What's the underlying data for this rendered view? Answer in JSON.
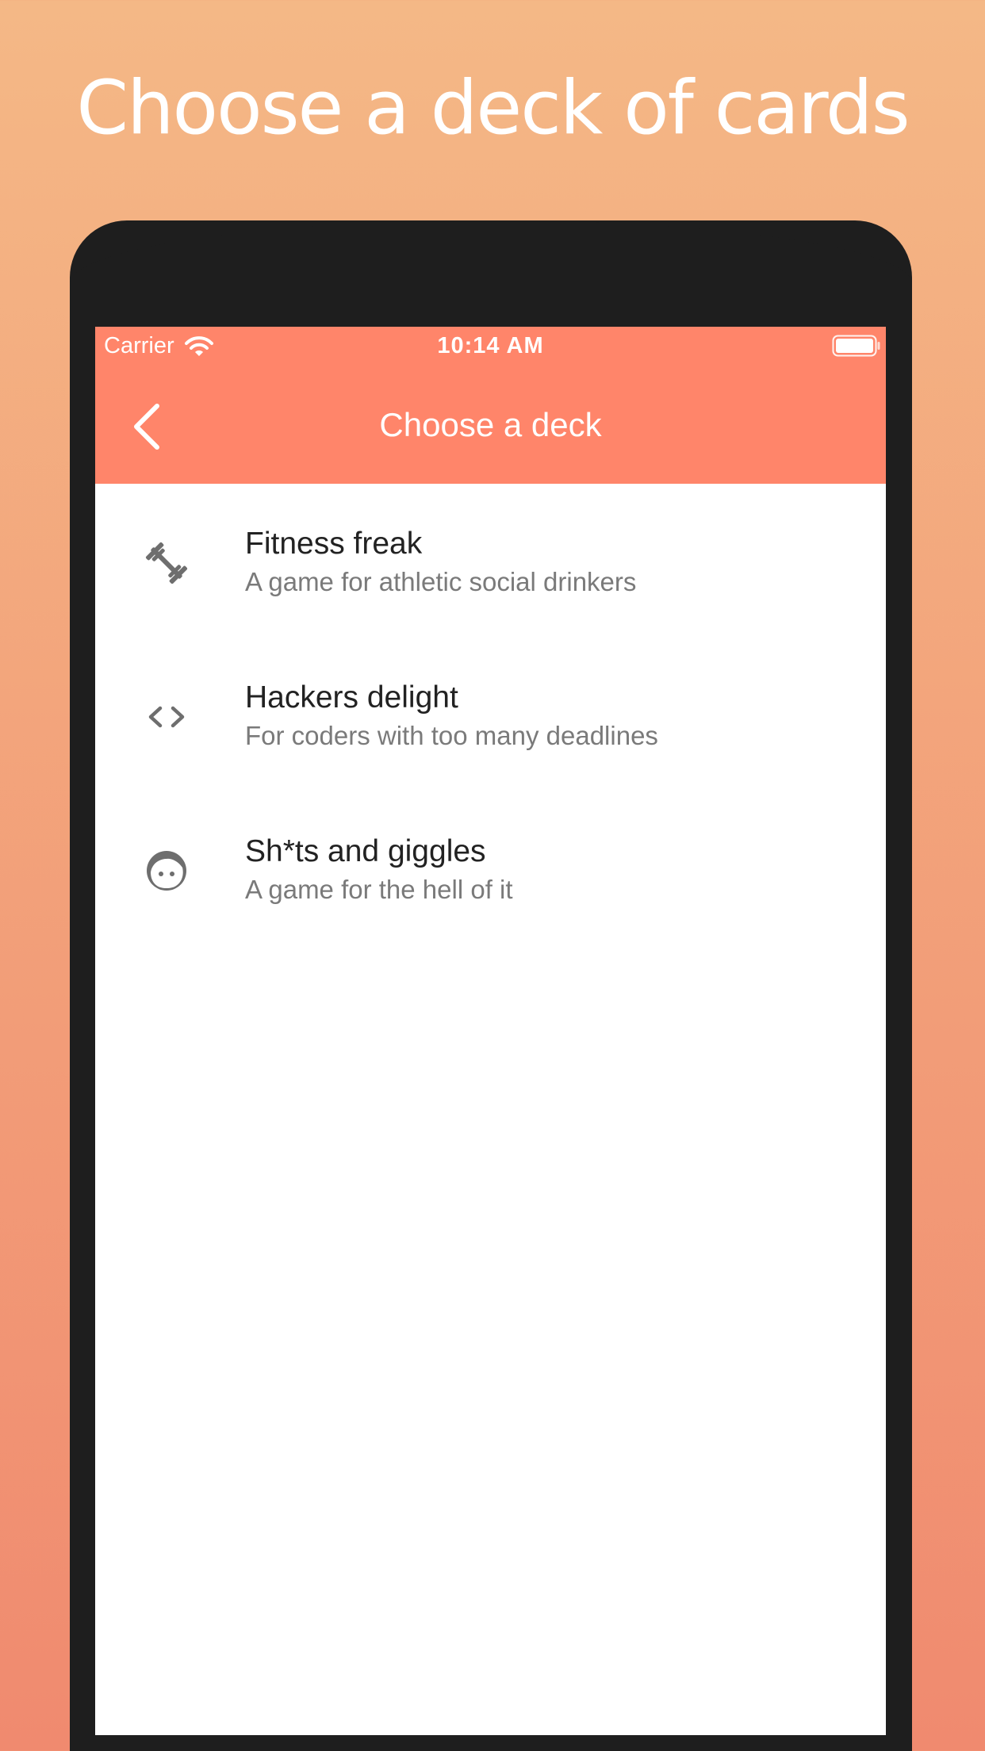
{
  "promo": {
    "heading": "Choose a deck of cards"
  },
  "status_bar": {
    "carrier": "Carrier",
    "time": "10:14 AM",
    "icons": [
      "wifi-icon",
      "battery-icon"
    ]
  },
  "nav": {
    "title": "Choose a deck",
    "back_icon": "chevron-left-icon"
  },
  "decks": [
    {
      "title": "Fitness freak",
      "subtitle": "A game for athletic social drinkers",
      "icon": "dumbbell-icon"
    },
    {
      "title": "Hackers delight",
      "subtitle": "For coders with too many deadlines",
      "icon": "code-icon"
    },
    {
      "title": "Sh*ts and giggles",
      "subtitle": "A game for the hell of it",
      "icon": "face-icon"
    }
  ],
  "colors": {
    "background_top": "#f4b886",
    "background_bottom": "#f08a6f",
    "accent": "#ff856a",
    "phone_frame": "#1e1e1e",
    "icon_gray": "#6e6e6e"
  }
}
